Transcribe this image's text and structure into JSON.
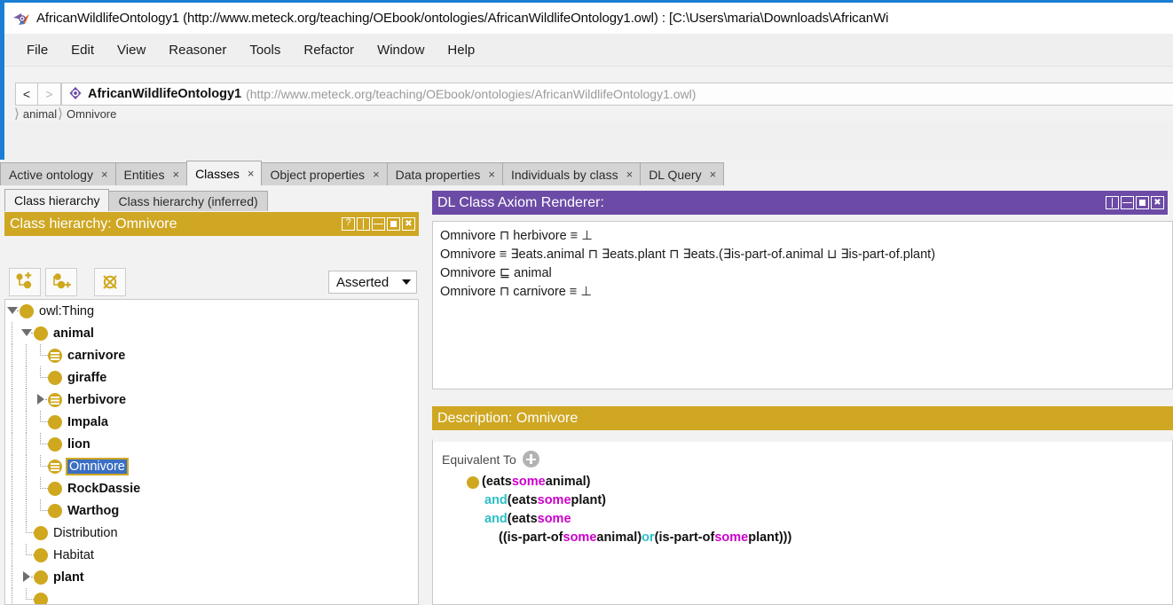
{
  "window": {
    "title": "AfricanWildlifeOntology1 (http://www.meteck.org/teaching/OEbook/ontologies/AfricanWildlifeOntology1.owl) : [C:\\Users\\maria\\Downloads\\AfricanWi",
    "app_icon": "protege-icon"
  },
  "menubar": {
    "items": [
      {
        "label": "File"
      },
      {
        "label": "Edit"
      },
      {
        "label": "View"
      },
      {
        "label": "Reasoner"
      },
      {
        "label": "Tools"
      },
      {
        "label": "Refactor"
      },
      {
        "label": "Window"
      },
      {
        "label": "Help"
      }
    ]
  },
  "iribar": {
    "back_label": "<",
    "forward_label": ">",
    "ontology_name": "AfricanWildlifeOntology1",
    "ontology_iri": "(http://www.meteck.org/teaching/OEbook/ontologies/AfricanWildlifeOntology1.owl)",
    "breadcrumb": [
      "animal",
      "Omnivore"
    ]
  },
  "tabs": [
    {
      "label": "Active ontology",
      "active": false,
      "close": "×"
    },
    {
      "label": "Entities",
      "active": false,
      "close": "×"
    },
    {
      "label": "Classes",
      "active": true,
      "close": "×"
    },
    {
      "label": "Object properties",
      "active": false,
      "close": "×"
    },
    {
      "label": "Data properties",
      "active": false,
      "close": "×"
    },
    {
      "label": "Individuals by class",
      "active": false,
      "close": "×"
    },
    {
      "label": "DL Query",
      "active": false,
      "close": "×"
    }
  ],
  "class_hierarchy": {
    "subtabs": [
      {
        "label": "Class hierarchy",
        "active": true
      },
      {
        "label": "Class hierarchy (inferred)",
        "active": false
      }
    ],
    "header_title": "Class hierarchy: Omnivore",
    "header_buttons": [
      "help-icon",
      "split-vertical-icon",
      "split-horizontal-icon",
      "maximize-icon",
      "close-icon"
    ],
    "toolbar": {
      "add_subclass_tooltip": "add-subclass-icon",
      "add_sibling_tooltip": "add-sibling-class-icon",
      "delete_class_tooltip": "delete-class-icon",
      "mode_value": "Asserted"
    },
    "tree": [
      {
        "label": "owl:Thing",
        "depth": 0,
        "toggle": "down",
        "icon": "class",
        "bold": false,
        "selected": false
      },
      {
        "label": "animal",
        "depth": 1,
        "toggle": "down",
        "icon": "class",
        "bold": true,
        "selected": false
      },
      {
        "label": "carnivore",
        "depth": 2,
        "toggle": "none",
        "icon": "defined",
        "bold": true,
        "selected": false
      },
      {
        "label": "giraffe",
        "depth": 2,
        "toggle": "none",
        "icon": "class",
        "bold": true,
        "selected": false
      },
      {
        "label": "herbivore",
        "depth": 2,
        "toggle": "right",
        "icon": "defined",
        "bold": true,
        "selected": false
      },
      {
        "label": "Impala",
        "depth": 2,
        "toggle": "none",
        "icon": "class",
        "bold": true,
        "selected": false
      },
      {
        "label": "lion",
        "depth": 2,
        "toggle": "none",
        "icon": "class",
        "bold": true,
        "selected": false
      },
      {
        "label": "Omnivore",
        "depth": 2,
        "toggle": "none",
        "icon": "defined",
        "bold": false,
        "selected": true
      },
      {
        "label": "RockDassie",
        "depth": 2,
        "toggle": "none",
        "icon": "class",
        "bold": true,
        "selected": false
      },
      {
        "label": "Warthog",
        "depth": 2,
        "toggle": "none",
        "icon": "class",
        "bold": true,
        "selected": false
      },
      {
        "label": "Distribution",
        "depth": 1,
        "toggle": "none",
        "icon": "class",
        "bold": false,
        "selected": false
      },
      {
        "label": "Habitat",
        "depth": 1,
        "toggle": "none",
        "icon": "class",
        "bold": false,
        "selected": false
      },
      {
        "label": "plant",
        "depth": 1,
        "toggle": "right",
        "icon": "class",
        "bold": true,
        "selected": false
      }
    ]
  },
  "dl_renderer": {
    "header_title": "DL Class Axiom Renderer:",
    "header_buttons": [
      "split-vertical-icon",
      "split-horizontal-icon",
      "maximize-icon",
      "close-icon"
    ],
    "axioms": [
      "Omnivore ⊓ herbivore ≡ ⊥",
      "Omnivore ≡ ∃eats.animal ⊓ ∃eats.plant ⊓ ∃eats.(∃is-part-of.animal ⊔ ∃is-part-of.plant)",
      "Omnivore ⊑ animal",
      "Omnivore ⊓ carnivore ≡ ⊥"
    ]
  },
  "description": {
    "header_title": "Description: Omnivore",
    "equivalent_to_label": "Equivalent To",
    "add_button": "plus-icon",
    "expression_lines": [
      [
        {
          "t": "bullet"
        },
        {
          "t": "plain",
          "v": "(eats "
        },
        {
          "t": "some",
          "v": "some"
        },
        {
          "t": "plain",
          "v": " animal)"
        }
      ],
      [
        {
          "t": "indent1"
        },
        {
          "t": "op",
          "v": "and"
        },
        {
          "t": "plain",
          "v": " (eats "
        },
        {
          "t": "some",
          "v": "some"
        },
        {
          "t": "plain",
          "v": " plant)"
        }
      ],
      [
        {
          "t": "indent1"
        },
        {
          "t": "op",
          "v": "and"
        },
        {
          "t": "plain",
          "v": " (eats "
        },
        {
          "t": "some",
          "v": "some"
        }
      ],
      [
        {
          "t": "indent2"
        },
        {
          "t": "plain",
          "v": "((is-part-of "
        },
        {
          "t": "some",
          "v": "some"
        },
        {
          "t": "plain",
          "v": " animal) "
        },
        {
          "t": "op",
          "v": "or"
        },
        {
          "t": "plain",
          "v": " (is-part-of "
        },
        {
          "t": "some",
          "v": "some"
        },
        {
          "t": "plain",
          "v": " plant)))"
        }
      ]
    ]
  },
  "colors": {
    "accent_gold": "#cfa723",
    "accent_purple": "#6c4ba6",
    "selection_blue": "#3b6fc4",
    "keyword_some": "#cc00cc",
    "keyword_op": "#2bbfc6",
    "window_border": "#1a7fd4"
  }
}
